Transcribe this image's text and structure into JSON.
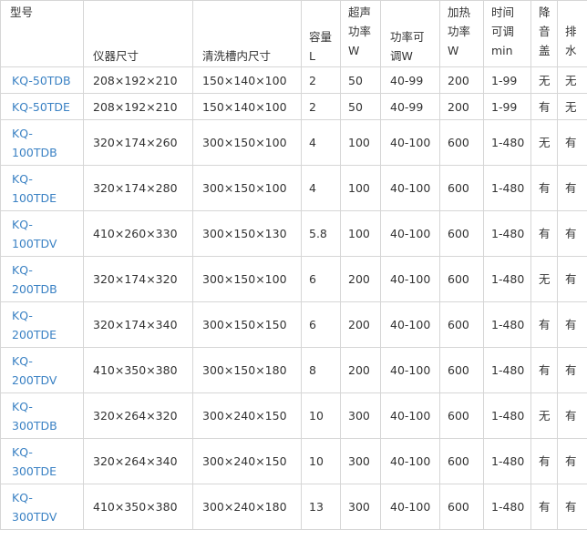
{
  "headers": {
    "model": "型号",
    "instrument_size": "仪器尺寸",
    "tank_size": "清洗槽内尺寸",
    "capacity": [
      "容量",
      "L"
    ],
    "ultrasonic_power": [
      "超声",
      "功率",
      "W"
    ],
    "adjustable_power": [
      "功率可",
      "调W"
    ],
    "heating_power": [
      "加热",
      "功率",
      "W"
    ],
    "time_adjust": [
      "时间",
      "可调",
      "min"
    ],
    "noise_lid": [
      "降",
      "音",
      "盖"
    ],
    "drain": [
      "排",
      "水"
    ]
  },
  "rows": [
    {
      "model": [
        "KQ-50TDB"
      ],
      "instrument_size": "208×192×210",
      "tank_size": "150×140×100",
      "capacity": "2",
      "ultrasonic_power": "50",
      "adjustable_power": "40-99",
      "heating_power": "200",
      "time_adjust": "1-99",
      "noise_lid": "无",
      "drain": "无"
    },
    {
      "model": [
        "KQ-50TDE"
      ],
      "instrument_size": "208×192×210",
      "tank_size": "150×140×100",
      "capacity": "2",
      "ultrasonic_power": "50",
      "adjustable_power": "40-99",
      "heating_power": "200",
      "time_adjust": "1-99",
      "noise_lid": "有",
      "drain": "无"
    },
    {
      "model": [
        "KQ-",
        "100TDB"
      ],
      "instrument_size": "320×174×260",
      "tank_size": "300×150×100",
      "capacity": "4",
      "ultrasonic_power": "100",
      "adjustable_power": "40-100",
      "heating_power": "600",
      "time_adjust": "1-480",
      "noise_lid": "无",
      "drain": "有"
    },
    {
      "model": [
        "KQ-",
        "100TDE"
      ],
      "instrument_size": "320×174×280",
      "tank_size": "300×150×100",
      "capacity": "4",
      "ultrasonic_power": "100",
      "adjustable_power": "40-100",
      "heating_power": "600",
      "time_adjust": "1-480",
      "noise_lid": "有",
      "drain": "有"
    },
    {
      "model": [
        "KQ-",
        "100TDV"
      ],
      "instrument_size": "410×260×330",
      "tank_size": "300×150×130",
      "capacity": "5.8",
      "ultrasonic_power": "100",
      "adjustable_power": "40-100",
      "heating_power": "600",
      "time_adjust": "1-480",
      "noise_lid": "有",
      "drain": "有"
    },
    {
      "model": [
        "KQ-",
        "200TDB"
      ],
      "instrument_size": "320×174×320",
      "tank_size": "300×150×100",
      "capacity": "6",
      "ultrasonic_power": "200",
      "adjustable_power": "40-100",
      "heating_power": "600",
      "time_adjust": "1-480",
      "noise_lid": "无",
      "drain": "有"
    },
    {
      "model": [
        "KQ-",
        "200TDE"
      ],
      "instrument_size": "320×174×340",
      "tank_size": "300×150×150",
      "capacity": "6",
      "ultrasonic_power": "200",
      "adjustable_power": "40-100",
      "heating_power": "600",
      "time_adjust": "1-480",
      "noise_lid": "有",
      "drain": "有"
    },
    {
      "model": [
        "KQ-",
        "200TDV"
      ],
      "instrument_size": "410×350×380",
      "tank_size": "300×150×180",
      "capacity": "8",
      "ultrasonic_power": "200",
      "adjustable_power": "40-100",
      "heating_power": "600",
      "time_adjust": "1-480",
      "noise_lid": "有",
      "drain": "有"
    },
    {
      "model": [
        "KQ-",
        "300TDB"
      ],
      "instrument_size": "320×264×320",
      "tank_size": "300×240×150",
      "capacity": "10",
      "ultrasonic_power": "300",
      "adjustable_power": "40-100",
      "heating_power": "600",
      "time_adjust": "1-480",
      "noise_lid": "无",
      "drain": "有"
    },
    {
      "model": [
        "KQ-",
        "300TDE"
      ],
      "instrument_size": "320×264×340",
      "tank_size": "300×240×150",
      "capacity": "10",
      "ultrasonic_power": "300",
      "adjustable_power": "40-100",
      "heating_power": "600",
      "time_adjust": "1-480",
      "noise_lid": "有",
      "drain": "有"
    },
    {
      "model": [
        "KQ-",
        "300TDV"
      ],
      "instrument_size": "410×350×380",
      "tank_size": "300×240×180",
      "capacity": "13",
      "ultrasonic_power": "300",
      "adjustable_power": "40-100",
      "heating_power": "600",
      "time_adjust": "1-480",
      "noise_lid": "有",
      "drain": "有"
    }
  ],
  "colors": {
    "model_link": "#3b82c4",
    "text": "#333333",
    "border": "#d6d6d6"
  }
}
